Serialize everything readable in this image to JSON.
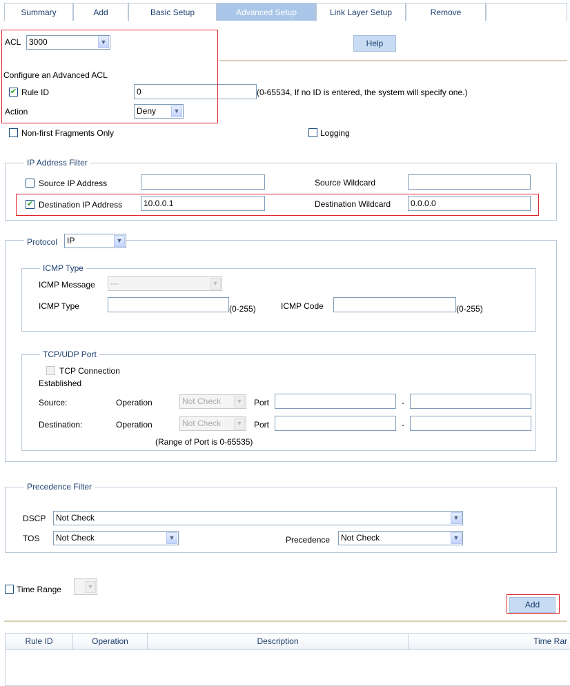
{
  "tabs": [
    "Summary",
    "Add",
    "Basic Setup",
    "Advanced Setup",
    "Link Layer Setup",
    "Remove"
  ],
  "acl": {
    "label": "ACL",
    "value": "3000"
  },
  "help_label": "Help",
  "configure_title": "Configure an Advanced ACL",
  "rule_id": {
    "label": "Rule ID",
    "value": "0",
    "hint": "(0-65534, If no ID is entered, the system will specify one.)",
    "checked": true
  },
  "action": {
    "label": "Action",
    "value": "Deny"
  },
  "nonfirst_label": "Non-first Fragments Only",
  "logging_label": "Logging",
  "ip_filter": {
    "legend": "IP Address Filter",
    "source_ip_label": "Source IP Address",
    "source_ip_value": "",
    "source_wildcard_label": "Source Wildcard",
    "source_wildcard_value": "",
    "dest_ip_label": "Destination IP Address",
    "dest_ip_value": "10.0.0.1",
    "dest_wildcard_label": "Destination Wildcard",
    "dest_wildcard_value": "0.0.0.0"
  },
  "protocol": {
    "label": "Protocol",
    "value": "IP"
  },
  "icmp": {
    "legend": "ICMP Type",
    "message_label": "ICMP Message",
    "message_value": "---",
    "type_label": "ICMP Type",
    "type_range": "(0-255)",
    "code_label": "ICMP Code",
    "code_range": "(0-255)"
  },
  "tcpudp": {
    "legend": "TCP/UDP Port",
    "tcp_conn_line1": "TCP Connection",
    "tcp_conn_line2": "Established",
    "source_label": "Source:",
    "dest_label": "Destination:",
    "operation_label": "Operation",
    "operation_value": "Not Check",
    "port_label": "Port",
    "dash": "-",
    "range_note": "(Range of Port is 0-65535)"
  },
  "precedence": {
    "legend": "Precedence Filter",
    "dscp_label": "DSCP",
    "dscp_value": "Not Check",
    "tos_label": "TOS",
    "tos_value": "Not Check",
    "prec_label": "Precedence",
    "prec_value": "Not Check"
  },
  "time_range_label": "Time Range",
  "add_label": "Add",
  "table_headers": [
    "Rule ID",
    "Operation",
    "Description",
    "Time Rar"
  ],
  "colors": {
    "tab_active": "#a9c6e8",
    "highlight": "#e0222b",
    "button": "#c7dcf3",
    "label_blue": "#1a3d6e"
  }
}
